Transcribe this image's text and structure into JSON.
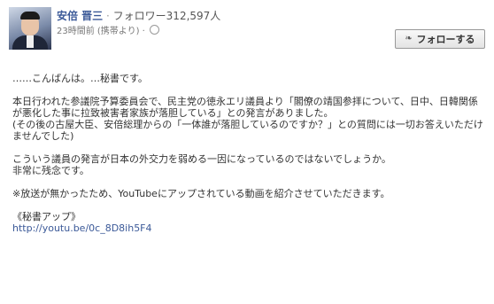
{
  "header": {
    "name": "安倍 晋三",
    "separator": "·",
    "followers": "フォロワー312,597人",
    "timestamp": "23時間前 (携帯より) ·",
    "privacy_icon": "globe-icon",
    "follow_button": "フォローする",
    "follow_icon": "rss-icon"
  },
  "post": {
    "greeting": "……こんばんは。…秘書です。",
    "para1": "本日行われた参議院予算委員会で、民主党の徳永エリ議員より「閣僚の靖国参拝について、日中、日韓関係が悪化した事に拉致被害者家族が落胆している」との発言がありました。",
    "para2": "(その後の古屋大臣、安倍総理からの「一体誰が落胆しているのですか？」との質問には一切お答えいただけませんでした)",
    "para3_line1": "こういう議員の発言が日本の外交力を弱める一因になっているのではないでしょうか。",
    "para3_line2": "非常に残念です。",
    "para4": "※放送が無かったため、YouTubeにアップされている動画を紹介させていただきます。",
    "signature": "《秘書アップ》",
    "link": "http://youtu.be/0c_8D8ih5F4"
  }
}
